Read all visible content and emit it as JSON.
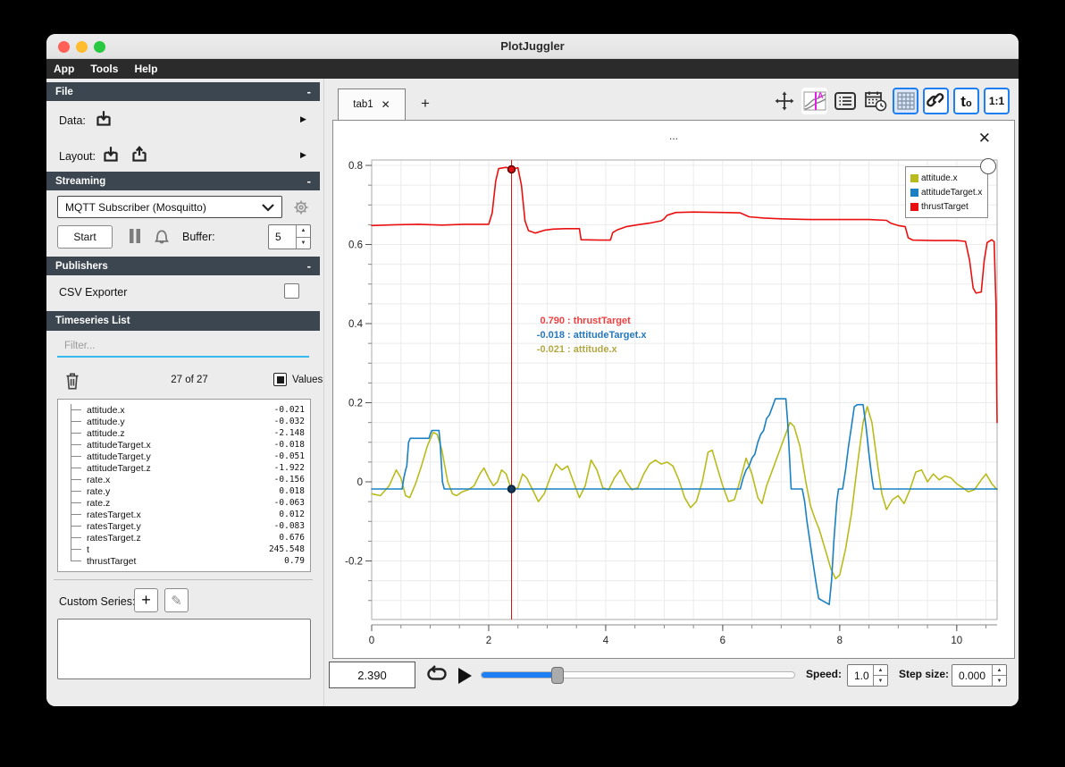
{
  "window": {
    "title": "PlotJuggler"
  },
  "menu": {
    "items": [
      "App",
      "Tools",
      "Help"
    ]
  },
  "sidebar": {
    "file": {
      "title": "File",
      "collapse": "-",
      "data_label": "Data:",
      "layout_label": "Layout:"
    },
    "streaming": {
      "title": "Streaming",
      "collapse": "-",
      "source_selected": "MQTT Subscriber (Mosquitto)",
      "start_label": "Start",
      "buffer_label": "Buffer:",
      "buffer_value": "5"
    },
    "publishers": {
      "title": "Publishers",
      "collapse": "-",
      "csv_label": "CSV Exporter"
    },
    "timeseries": {
      "title": "Timeseries List",
      "filter_placeholder": "Filter...",
      "count": "27 of 27",
      "values_label": "Values",
      "custom_series_label": "Custom Series:",
      "items": [
        {
          "name": "attitude.x",
          "value": "-0.021"
        },
        {
          "name": "attitude.y",
          "value": "-0.032"
        },
        {
          "name": "attitude.z",
          "value": "-2.148"
        },
        {
          "name": "attitudeTarget.x",
          "value": "-0.018"
        },
        {
          "name": "attitudeTarget.y",
          "value": "-0.051"
        },
        {
          "name": "attitudeTarget.z",
          "value": "-1.922"
        },
        {
          "name": "rate.x",
          "value": "-0.156"
        },
        {
          "name": "rate.y",
          "value": "0.018"
        },
        {
          "name": "rate.z",
          "value": "-0.063"
        },
        {
          "name": "ratesTarget.x",
          "value": "0.012"
        },
        {
          "name": "ratesTarget.y",
          "value": "-0.083"
        },
        {
          "name": "ratesTarget.z",
          "value": "0.676"
        },
        {
          "name": "t",
          "value": "245.548"
        },
        {
          "name": "thrustTarget",
          "value": "0.79"
        }
      ]
    }
  },
  "tabbar": {
    "tab_label": "tab1",
    "close": "✕",
    "add": "+"
  },
  "toolbar": {
    "t_main": "t",
    "t_sub": "o",
    "ratio_label": "1:1"
  },
  "plot": {
    "title": "...",
    "close": "✕",
    "legend": {
      "entries": [
        {
          "label": "attitude.x",
          "color": "#b9bb1c"
        },
        {
          "label": "attitudeTarget.x",
          "color": "#1a80c4"
        },
        {
          "label": "thrustTarget",
          "color": "#ea1010"
        }
      ]
    },
    "tooltip": {
      "lines": [
        {
          "value": "0.790",
          "label": "thrustTarget",
          "color": "#ee4040"
        },
        {
          "value": "-0.018",
          "label": "attitudeTarget.x",
          "color": "#2478be"
        },
        {
          "value": "-0.021",
          "label": "attitude.x",
          "color": "#b3a845"
        }
      ]
    }
  },
  "playback": {
    "time": "2.390",
    "speed_label": "Speed:",
    "speed_value": "1.0",
    "step_label": "Step size:",
    "step_value": "0.000"
  },
  "chart_data": {
    "type": "line",
    "title": "...",
    "xlabel": "",
    "ylabel": "",
    "xlim": [
      0,
      10.69
    ],
    "ylim": [
      -0.348,
      0.8136
    ],
    "grid": true,
    "legend_position": "top-right",
    "xticks": [
      {
        "v": 0,
        "label": "0"
      },
      {
        "v": 2,
        "label": "2"
      },
      {
        "v": 4,
        "label": "4"
      },
      {
        "v": 6,
        "label": "6"
      },
      {
        "v": 8,
        "label": "8"
      },
      {
        "v": 10,
        "label": "10"
      }
    ],
    "x_minor_step": 0.5,
    "yticks": [
      {
        "v": 0.8,
        "label": "0.8"
      },
      {
        "v": 0.6,
        "label": "0.6"
      },
      {
        "v": 0.4,
        "label": "0.4"
      },
      {
        "v": 0.2,
        "label": "0.2"
      },
      {
        "v": 0,
        "label": "0"
      },
      {
        "v": -0.2,
        "label": "-0.2"
      }
    ],
    "y_minor_step": 0.05,
    "cursor": {
      "x": 2.39,
      "color": "#e01010"
    },
    "markers": [
      {
        "x": 2.39,
        "y": 0.79,
        "color": "#e01010",
        "stroke": "#550000"
      },
      {
        "x": 2.39,
        "y": -0.018,
        "color": "#14395a",
        "stroke": "#062036"
      }
    ],
    "series": [
      {
        "name": "attitude.x",
        "color": "#b9bb1c",
        "points": [
          [
            0,
            -0.03
          ],
          [
            0.15,
            -0.035
          ],
          [
            0.3,
            -0.01
          ],
          [
            0.42,
            0.03
          ],
          [
            0.5,
            0.01
          ],
          [
            0.58,
            -0.035
          ],
          [
            0.65,
            -0.04
          ],
          [
            0.75,
            -0.005
          ],
          [
            0.85,
            0.04
          ],
          [
            0.95,
            0.09
          ],
          [
            1.05,
            0.125
          ],
          [
            1.12,
            0.12
          ],
          [
            1.2,
            0.08
          ],
          [
            1.3,
            0
          ],
          [
            1.38,
            -0.03
          ],
          [
            1.45,
            -0.035
          ],
          [
            1.55,
            -0.025
          ],
          [
            1.65,
            -0.02
          ],
          [
            1.75,
            -0.01
          ],
          [
            1.85,
            0.02
          ],
          [
            1.92,
            0.035
          ],
          [
            2,
            0.01
          ],
          [
            2.08,
            -0.01
          ],
          [
            2.15,
            0
          ],
          [
            2.22,
            0.03
          ],
          [
            2.3,
            0.02
          ],
          [
            2.39,
            -0.021
          ],
          [
            2.5,
            -0.015
          ],
          [
            2.58,
            0.02
          ],
          [
            2.65,
            0.01
          ],
          [
            2.75,
            -0.02
          ],
          [
            2.85,
            -0.05
          ],
          [
            2.95,
            -0.03
          ],
          [
            3.05,
            0.01
          ],
          [
            3.15,
            0.045
          ],
          [
            3.25,
            0.03
          ],
          [
            3.35,
            0.04
          ],
          [
            3.45,
            0
          ],
          [
            3.55,
            -0.04
          ],
          [
            3.65,
            -0.01
          ],
          [
            3.75,
            0.055
          ],
          [
            3.85,
            0.03
          ],
          [
            3.95,
            -0.015
          ],
          [
            4.05,
            -0.02
          ],
          [
            4.15,
            0.01
          ],
          [
            4.25,
            0.03
          ],
          [
            4.35,
            0
          ],
          [
            4.45,
            -0.02
          ],
          [
            4.55,
            -0.015
          ],
          [
            4.65,
            0.02
          ],
          [
            4.75,
            0.045
          ],
          [
            4.85,
            0.055
          ],
          [
            4.95,
            0.045
          ],
          [
            5.05,
            0.05
          ],
          [
            5.15,
            0.04
          ],
          [
            5.25,
            0.005
          ],
          [
            5.35,
            -0.04
          ],
          [
            5.45,
            -0.065
          ],
          [
            5.55,
            -0.05
          ],
          [
            5.65,
            0
          ],
          [
            5.75,
            0.075
          ],
          [
            5.82,
            0.08
          ],
          [
            5.9,
            0.04
          ],
          [
            6,
            -0.01
          ],
          [
            6.1,
            -0.05
          ],
          [
            6.2,
            -0.045
          ],
          [
            6.3,
            0.005
          ],
          [
            6.4,
            0.06
          ],
          [
            6.5,
            0.02
          ],
          [
            6.6,
            -0.04
          ],
          [
            6.67,
            -0.055
          ],
          [
            6.75,
            -0.01
          ],
          [
            6.85,
            0.03
          ],
          [
            6.95,
            0.07
          ],
          [
            7.05,
            0.11
          ],
          [
            7.15,
            0.15
          ],
          [
            7.22,
            0.14
          ],
          [
            7.32,
            0.09
          ],
          [
            7.42,
            0
          ],
          [
            7.5,
            -0.06
          ],
          [
            7.58,
            -0.095
          ],
          [
            7.65,
            -0.12
          ],
          [
            7.75,
            -0.17
          ],
          [
            7.85,
            -0.22
          ],
          [
            7.93,
            -0.245
          ],
          [
            8,
            -0.235
          ],
          [
            8.1,
            -0.17
          ],
          [
            8.2,
            -0.08
          ],
          [
            8.3,
            0.04
          ],
          [
            8.4,
            0.15
          ],
          [
            8.47,
            0.19
          ],
          [
            8.55,
            0.15
          ],
          [
            8.65,
            0.04
          ],
          [
            8.72,
            -0.03
          ],
          [
            8.8,
            -0.07
          ],
          [
            8.9,
            -0.045
          ],
          [
            9,
            -0.035
          ],
          [
            9.1,
            -0.055
          ],
          [
            9.2,
            -0.02
          ],
          [
            9.3,
            0.025
          ],
          [
            9.4,
            0.03
          ],
          [
            9.5,
            0
          ],
          [
            9.6,
            0.02
          ],
          [
            9.7,
            0.005
          ],
          [
            9.8,
            0.015
          ],
          [
            9.9,
            0.01
          ],
          [
            10,
            -0.005
          ],
          [
            10.1,
            -0.015
          ],
          [
            10.2,
            -0.025
          ],
          [
            10.3,
            -0.02
          ],
          [
            10.42,
            0.005
          ],
          [
            10.5,
            0.02
          ],
          [
            10.6,
            -0.005
          ],
          [
            10.69,
            -0.02
          ]
        ]
      },
      {
        "name": "attitudeTarget.x",
        "color": "#1a80c4",
        "points": [
          [
            0,
            -0.018
          ],
          [
            0.52,
            -0.018
          ],
          [
            0.55,
            0.01
          ],
          [
            0.58,
            0.03
          ],
          [
            0.6,
            0.04
          ],
          [
            0.63,
            0.1
          ],
          [
            0.66,
            0.11
          ],
          [
            0.98,
            0.11
          ],
          [
            1,
            0.12
          ],
          [
            1.03,
            0.13
          ],
          [
            1.15,
            0.13
          ],
          [
            1.17,
            0.1
          ],
          [
            1.19,
            0.05
          ],
          [
            1.21,
            0
          ],
          [
            1.24,
            -0.018
          ],
          [
            6.3,
            -0.018
          ],
          [
            6.35,
            0.01
          ],
          [
            6.4,
            0.03
          ],
          [
            6.45,
            0.04
          ],
          [
            6.5,
            0.06
          ],
          [
            6.55,
            0.07
          ],
          [
            6.6,
            0.1
          ],
          [
            6.65,
            0.12
          ],
          [
            6.7,
            0.13
          ],
          [
            6.75,
            0.16
          ],
          [
            6.8,
            0.17
          ],
          [
            6.85,
            0.19
          ],
          [
            6.9,
            0.21
          ],
          [
            7.08,
            0.21
          ],
          [
            7.11,
            0.15
          ],
          [
            7.14,
            0.07
          ],
          [
            7.17,
            -0.018
          ],
          [
            7.36,
            -0.018
          ],
          [
            7.4,
            -0.05
          ],
          [
            7.44,
            -0.1
          ],
          [
            7.48,
            -0.14
          ],
          [
            7.52,
            -0.18
          ],
          [
            7.56,
            -0.22
          ],
          [
            7.6,
            -0.26
          ],
          [
            7.64,
            -0.295
          ],
          [
            7.7,
            -0.3
          ],
          [
            7.82,
            -0.31
          ],
          [
            7.86,
            -0.25
          ],
          [
            7.9,
            -0.15
          ],
          [
            7.95,
            -0.05
          ],
          [
            7.98,
            -0.018
          ],
          [
            8.05,
            -0.018
          ],
          [
            8.1,
            0.03
          ],
          [
            8.15,
            0.09
          ],
          [
            8.2,
            0.14
          ],
          [
            8.25,
            0.19
          ],
          [
            8.3,
            0.195
          ],
          [
            8.4,
            0.195
          ],
          [
            8.45,
            0.14
          ],
          [
            8.5,
            0.07
          ],
          [
            8.55,
            0.01
          ],
          [
            8.58,
            -0.018
          ],
          [
            10.69,
            -0.018
          ]
        ]
      },
      {
        "name": "thrustTarget",
        "color": "#ea1010",
        "points": [
          [
            0,
            0.648
          ],
          [
            0.4,
            0.65
          ],
          [
            0.8,
            0.651
          ],
          [
            1.2,
            0.649
          ],
          [
            1.6,
            0.651
          ],
          [
            2,
            0.651
          ],
          [
            2.06,
            0.68
          ],
          [
            2.12,
            0.76
          ],
          [
            2.17,
            0.792
          ],
          [
            2.3,
            0.795
          ],
          [
            2.39,
            0.79
          ],
          [
            2.5,
            0.794
          ],
          [
            2.56,
            0.75
          ],
          [
            2.62,
            0.66
          ],
          [
            2.68,
            0.635
          ],
          [
            2.8,
            0.629
          ],
          [
            2.95,
            0.636
          ],
          [
            3.1,
            0.639
          ],
          [
            3.3,
            0.64
          ],
          [
            3.55,
            0.64
          ],
          [
            3.58,
            0.612
          ],
          [
            3.9,
            0.611
          ],
          [
            4.08,
            0.611
          ],
          [
            4.12,
            0.63
          ],
          [
            4.2,
            0.637
          ],
          [
            4.35,
            0.645
          ],
          [
            4.55,
            0.65
          ],
          [
            4.75,
            0.654
          ],
          [
            4.95,
            0.66
          ],
          [
            5,
            0.665
          ],
          [
            5.05,
            0.674
          ],
          [
            5.2,
            0.681
          ],
          [
            5.5,
            0.682
          ],
          [
            6,
            0.681
          ],
          [
            6.3,
            0.68
          ],
          [
            6.45,
            0.67
          ],
          [
            6.7,
            0.667
          ],
          [
            7,
            0.665
          ],
          [
            7.5,
            0.663
          ],
          [
            8,
            0.663
          ],
          [
            8.5,
            0.663
          ],
          [
            8.8,
            0.661
          ],
          [
            8.87,
            0.654
          ],
          [
            9,
            0.648
          ],
          [
            9.12,
            0.645
          ],
          [
            9.17,
            0.617
          ],
          [
            9.25,
            0.611
          ],
          [
            9.6,
            0.61
          ],
          [
            10,
            0.61
          ],
          [
            10.15,
            0.608
          ],
          [
            10.22,
            0.56
          ],
          [
            10.28,
            0.49
          ],
          [
            10.33,
            0.477
          ],
          [
            10.42,
            0.48
          ],
          [
            10.47,
            0.56
          ],
          [
            10.52,
            0.605
          ],
          [
            10.6,
            0.612
          ],
          [
            10.64,
            0.607
          ],
          [
            10.67,
            0.45
          ],
          [
            10.69,
            0.15
          ]
        ]
      }
    ]
  }
}
